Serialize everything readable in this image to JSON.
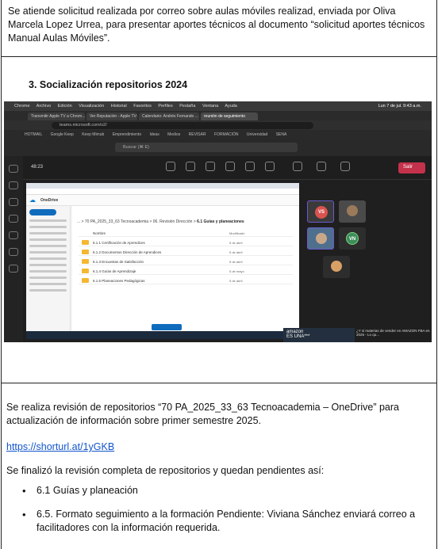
{
  "intro_paragraph": "Se atiende solicitud realizada por correo sobre aulas móviles realizad, enviada por Oliva Marcela Lopez Urrea, para presentar aportes técnicos al documento “solicitud aportes técnicos Manual Aulas Móviles”.",
  "section_heading": "3.  Socialización repositorios 2024",
  "screenshot": {
    "menu_bar": [
      "Chrome",
      "Archivo",
      "Edición",
      "Visualización",
      "Historial",
      "Favoritos",
      "Perfiles",
      "Pestaña",
      "Ventana",
      "Ayuda"
    ],
    "clock": "Lun 7 de jul. 9:43 a.m.",
    "url": "teams.microsoft.com/v2/",
    "tabs": [
      "Transmitir Apple TV a Chrom...",
      "Ver Reputación - Apple TV+",
      "Calendario: Andrés Fernando ...",
      "reunión de seguimiento"
    ],
    "bookmarks": [
      "HOTMAIL",
      "Google Keep",
      "Keep Mimub",
      "Emprendimiento",
      "Ideas",
      "Medios",
      "REVISAR",
      "FORMACIÓN",
      "Universidad",
      "SENA"
    ],
    "search_placeholder": "Buscar (⌘ E)",
    "meeting_timer": "48:23",
    "leave_label": "Salir",
    "onedrive_app": "OneDrive",
    "breadcrumb": "... > 70 PA_2025_33_63 Tecnoacademia > 06. Revisión Dirección >",
    "breadcrumb_current": "6.1 Guías y planeaciones",
    "folders": [
      {
        "name": "Nombre",
        "date": "Modificado"
      },
      {
        "name": "6.1.1 Certificación de Aprendices",
        "date": "5 de abril"
      },
      {
        "name": "6.1.2 Documentos Dirección de Aprendices",
        "date": "5 de abril"
      },
      {
        "name": "6.1.3 Encuestas de Satisfacción",
        "date": "5 de abril"
      },
      {
        "name": "6.1.4 Guías de Aprendizaje",
        "date": "5 de mayo"
      },
      {
        "name": "6.1.5 Planeaciones Pedagógicas",
        "date": "5 de abril"
      }
    ],
    "avatars": [
      "VS",
      "VN"
    ],
    "ad_title": "amazon",
    "ad_caption": "ES UNA***",
    "ad_text": "¿Y si materias de vender en AMAZON FBA en 2025 - Lo qu..."
  },
  "review_paragraph": "Se realiza revisión de repositorios “70 PA_2025_33_63 Tecnoacademia – OneDrive” para actualización de información sobre primer semestre 2025.",
  "link_text": "https://shorturl.at/1yGKB",
  "final_paragraph": "Se finalizó la revisión completa de repositorios y quedan pendientes así:",
  "pending_items": [
    "6.1 Guías y planeación",
    "6.5. Formato seguimiento a la formación Pendiente: Viviana Sánchez enviará correo a facilitadores con la información requerida."
  ],
  "colors": {
    "link": "#1155cc",
    "teams_leave": "#c4314b",
    "onedrive_blue": "#0f6cbd",
    "folder": "#f5b731"
  }
}
